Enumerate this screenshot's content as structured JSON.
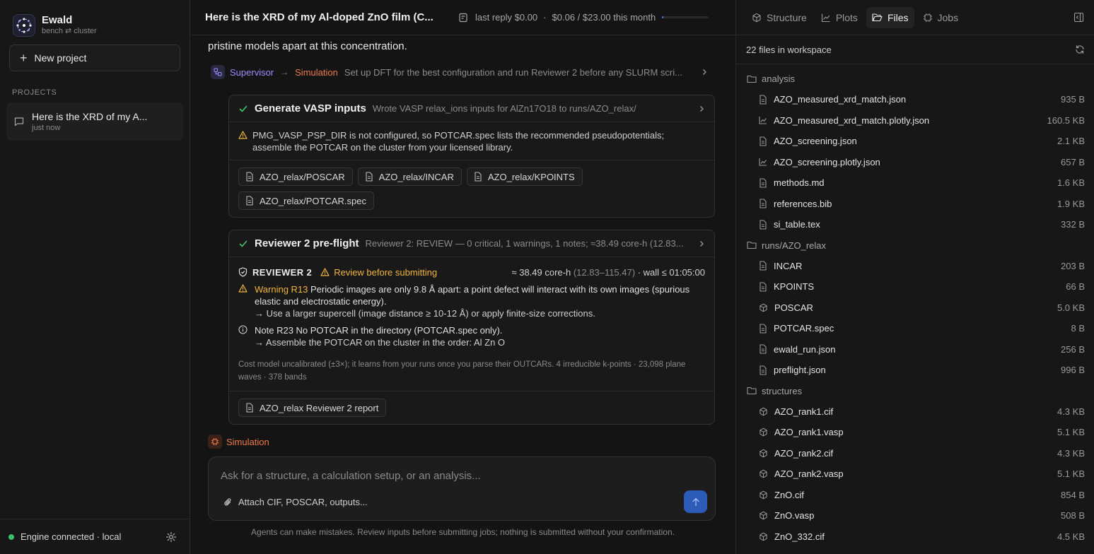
{
  "app": {
    "name": "Ewald",
    "subtitle": "bench ⇄ cluster"
  },
  "sidebar": {
    "new_project_label": "New project",
    "projects_label": "PROJECTS",
    "projects": [
      {
        "title": "Here is the XRD of my A...",
        "time": "just now"
      }
    ],
    "status": "Engine connected · local"
  },
  "header": {
    "title": "Here is the XRD of my Al-doped ZnO film (C...",
    "last_reply": "last reply $0.00",
    "separator": "·",
    "spend": "$0.06 / $23.00 this month",
    "budget_used_fraction": 0.0026,
    "budget_color": "#4a78ff"
  },
  "conversation": {
    "intro_tail": "pristine models apart at this concentration.",
    "route": {
      "from": "Supervisor",
      "to": "Simulation",
      "arrow": "→",
      "description": "Set up DFT for the best configuration and run Reviewer 2 before any SLURM scri..."
    },
    "step1": {
      "title": "Generate VASP inputs",
      "description": "Wrote VASP relax_ions inputs for AlZn17O18 to runs/AZO_relax/",
      "warning": "PMG_VASP_PSP_DIR is not configured, so POTCAR.spec lists the recommended pseudopotentials; assemble the POTCAR on the cluster from your licensed library.",
      "files": [
        "AZO_relax/POSCAR",
        "AZO_relax/INCAR",
        "AZO_relax/KPOINTS",
        "AZO_relax/POTCAR.spec"
      ]
    },
    "step2": {
      "title": "Reviewer 2 pre-flight",
      "description": "Reviewer 2: REVIEW — 0 critical, 1 warnings, 1 notes; ≈38.49 core-h (12.83...",
      "reviewer_label": "REVIEWER 2",
      "status": "Review before submitting",
      "cost_main": "≈ 38.49 core-h",
      "cost_range": "(12.83–115.47)",
      "wall": "· wall ≤ 01:05:00",
      "warning_tag": "Warning R13",
      "warning_text": "Periodic images are only 9.8 Å apart: a point defect will interact with its own images (spurious elastic and electrostatic energy).",
      "warning_fix": "→ Use a larger supercell (image distance ≥ 10-12 Å) or apply finite-size corrections.",
      "note_text": "Note R23 No POTCAR in the directory (POTCAR.spec only).",
      "note_fix": "→ Assemble the POTCAR on the cluster in the order: Al Zn O",
      "cost_note": "Cost model uncalibrated (±3×); it learns from your runs once you parse their OUTCARs. 4 irreducible k-points · 23,098 plane waves · 378 bands",
      "report": "AZO_relax Reviewer 2 report"
    },
    "active_agent": "Simulation"
  },
  "composer": {
    "placeholder": "Ask for a structure, a calculation setup, or an analysis...",
    "attach_label": "Attach CIF, POSCAR, outputs...",
    "disclaimer": "Agents can make mistakes. Review inputs before submitting jobs; nothing is submitted without your confirmation."
  },
  "panel": {
    "tabs": [
      "Structure",
      "Plots",
      "Files",
      "Jobs"
    ],
    "active_tab": "Files",
    "file_count": "22 files in workspace",
    "folders": [
      {
        "name": "analysis",
        "files": [
          {
            "name": "AZO_measured_xrd_match.json",
            "size": "935 B",
            "icon": "file-icon"
          },
          {
            "name": "AZO_measured_xrd_match.plotly.json",
            "size": "160.5 KB",
            "icon": "chart-icon"
          },
          {
            "name": "AZO_screening.json",
            "size": "2.1 KB",
            "icon": "file-icon"
          },
          {
            "name": "AZO_screening.plotly.json",
            "size": "657 B",
            "icon": "chart-icon"
          },
          {
            "name": "methods.md",
            "size": "1.6 KB",
            "icon": "file-icon"
          },
          {
            "name": "references.bib",
            "size": "1.9 KB",
            "icon": "file-icon"
          },
          {
            "name": "si_table.tex",
            "size": "332 B",
            "icon": "file-icon"
          }
        ]
      },
      {
        "name": "runs/AZO_relax",
        "files": [
          {
            "name": "INCAR",
            "size": "203 B",
            "icon": "file-icon"
          },
          {
            "name": "KPOINTS",
            "size": "66 B",
            "icon": "file-icon"
          },
          {
            "name": "POSCAR",
            "size": "5.0 KB",
            "icon": "cube-icon"
          },
          {
            "name": "POTCAR.spec",
            "size": "8 B",
            "icon": "file-icon"
          },
          {
            "name": "ewald_run.json",
            "size": "256 B",
            "icon": "file-icon"
          },
          {
            "name": "preflight.json",
            "size": "996 B",
            "icon": "file-icon"
          }
        ]
      },
      {
        "name": "structures",
        "files": [
          {
            "name": "AZO_rank1.cif",
            "size": "4.3 KB",
            "icon": "cube-icon"
          },
          {
            "name": "AZO_rank1.vasp",
            "size": "5.1 KB",
            "icon": "cube-icon"
          },
          {
            "name": "AZO_rank2.cif",
            "size": "4.3 KB",
            "icon": "cube-icon"
          },
          {
            "name": "AZO_rank2.vasp",
            "size": "5.1 KB",
            "icon": "cube-icon"
          },
          {
            "name": "ZnO.cif",
            "size": "854 B",
            "icon": "cube-icon"
          },
          {
            "name": "ZnO.vasp",
            "size": "508 B",
            "icon": "cube-icon"
          },
          {
            "name": "ZnO_332.cif",
            "size": "4.5 KB",
            "icon": "cube-icon"
          }
        ]
      }
    ]
  },
  "colors": {
    "accent_purple": "#9d8cff",
    "accent_orange": "#ef7a4a",
    "success": "#3fc46c",
    "warning": "#f2b53c",
    "send_button": "#2d5bb8"
  }
}
